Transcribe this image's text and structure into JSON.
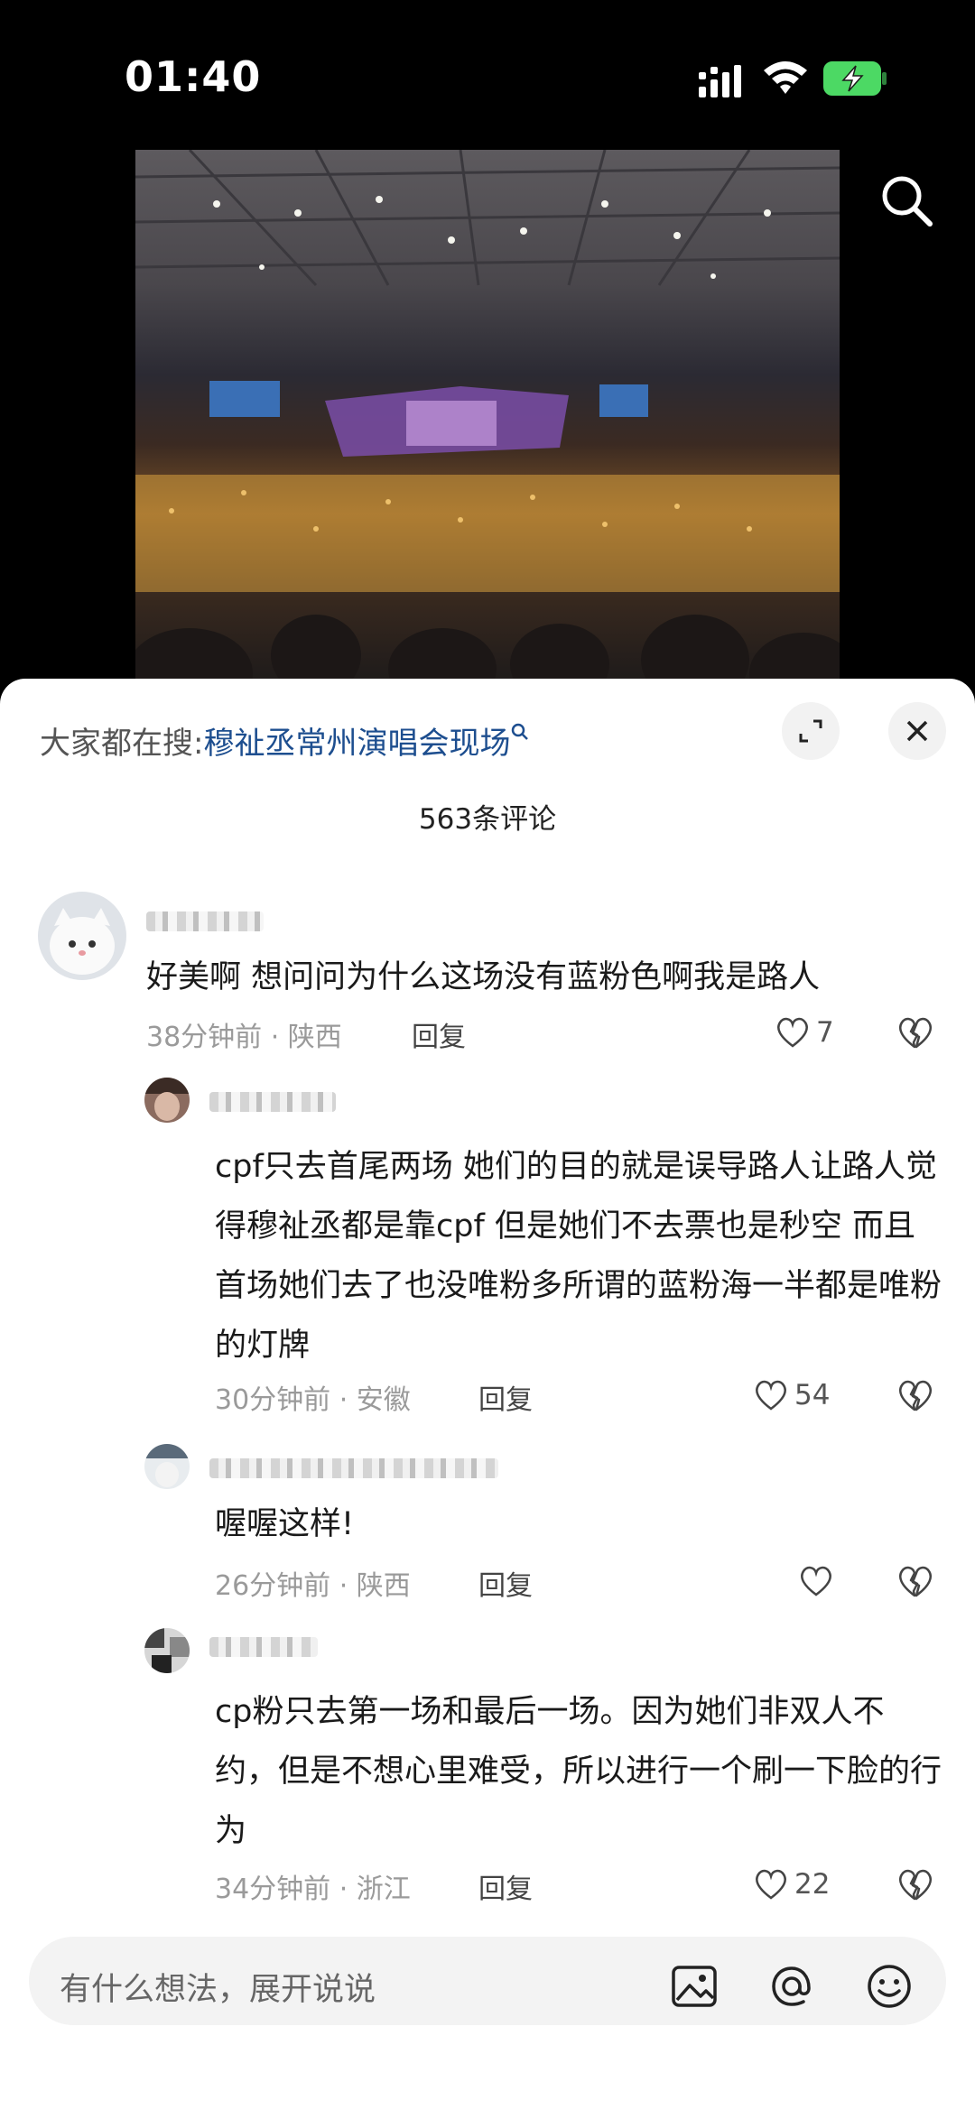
{
  "status": {
    "time": "01:40"
  },
  "hot_search": {
    "prefix": "大家都在搜:",
    "keyword": "穆祉丞常州演唱会现场"
  },
  "comments_header": {
    "count_label": "563条评论"
  },
  "comments": [
    {
      "text": "好美啊 想问问为什么这场没有蓝粉色啊我是路人",
      "time_loc": "38分钟前 · 陕西",
      "reply": "回复",
      "likes": "7"
    },
    {
      "text": "cpf只去首尾两场 她们的目的就是误导路人让路人觉得穆祉丞都是靠cpf 但是她们不去票也是秒空 而且首场她们去了也没唯粉多所谓的蓝粉海一半都是唯粉的灯牌",
      "time_loc": "30分钟前 · 安徽",
      "reply": "回复",
      "likes": "54"
    },
    {
      "text": "喔喔这样!",
      "time_loc": "26分钟前 · 陕西",
      "reply": "回复",
      "likes": ""
    },
    {
      "text": "cp粉只去第一场和最后一场。因为她们非双人不约，但是不想心里难受，所以进行一个刷一下脸的行为",
      "time_loc": "34分钟前 · 浙江",
      "reply": "回复",
      "likes": "22"
    }
  ],
  "input": {
    "placeholder": "有什么想法，展开说说"
  },
  "icons": [
    "signal-icon",
    "wifi-icon",
    "battery-charging-icon",
    "search-icon",
    "expand-icon",
    "close-icon",
    "heart-icon",
    "broken-heart-icon",
    "image-icon",
    "at-icon",
    "emoji-icon"
  ],
  "colors": {
    "keyword": "#1d4e8f",
    "battery": "#4cd964",
    "meta": "#9a9a9a"
  }
}
